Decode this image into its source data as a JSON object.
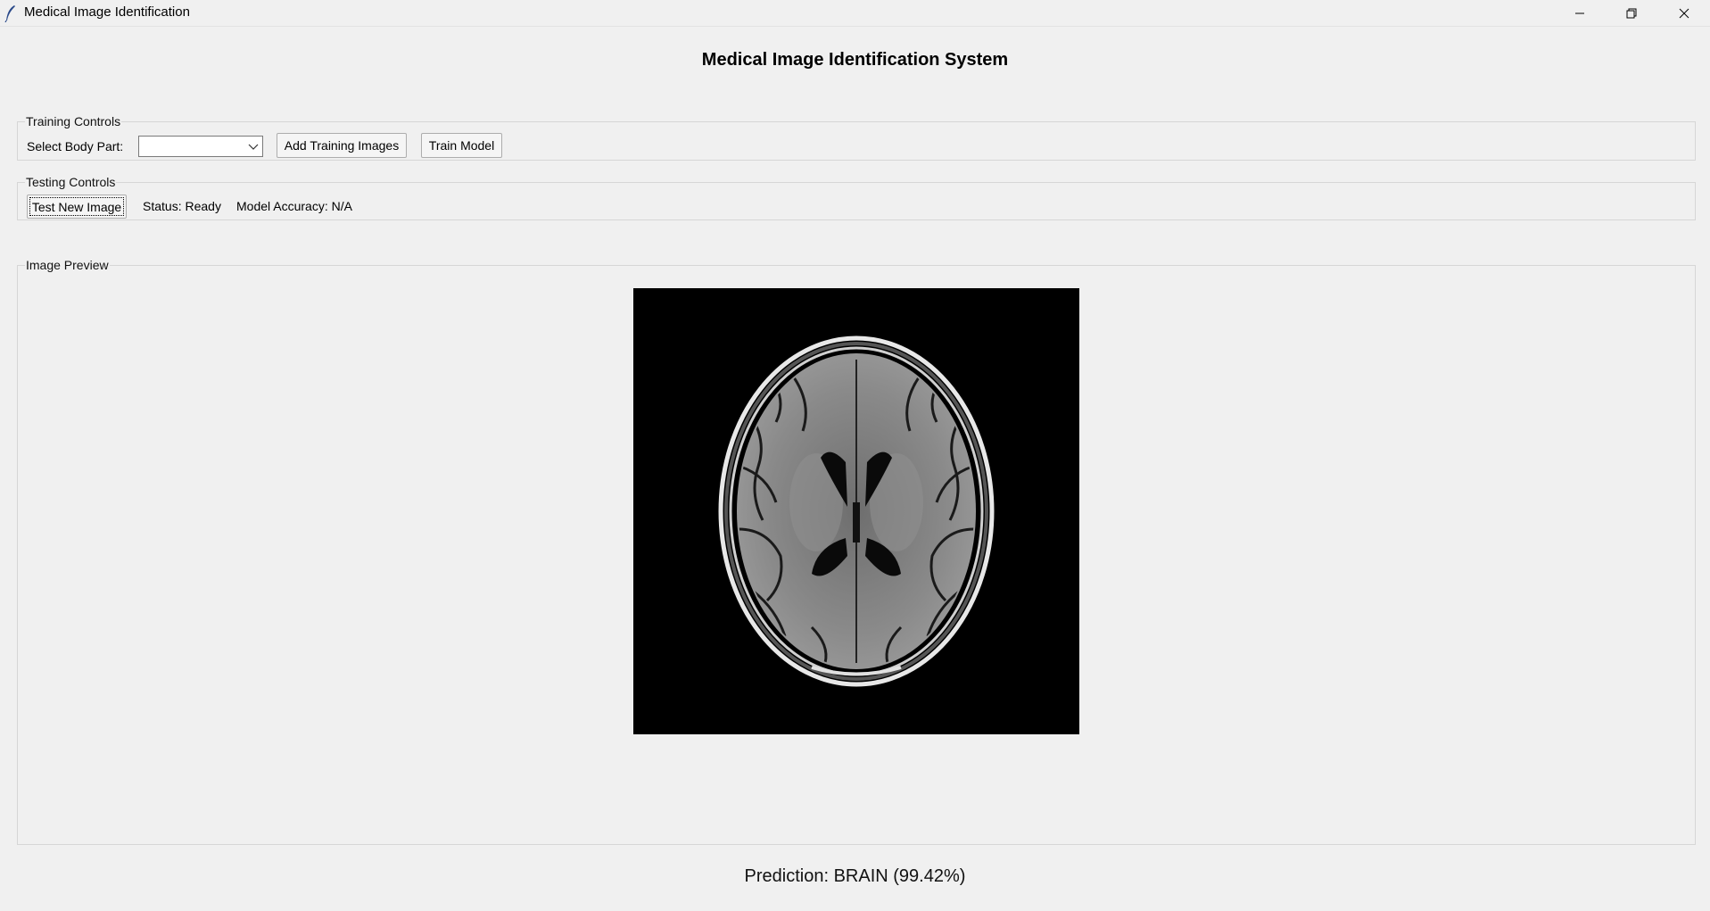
{
  "window": {
    "title": "Medical Image Identification",
    "icons": {
      "app": "feather-icon",
      "minimize": "minimize-icon",
      "maximize": "restore-icon",
      "close": "close-icon"
    }
  },
  "heading": "Medical Image Identification System",
  "training": {
    "group_label": "Training Controls",
    "body_part_label": "Select Body Part:",
    "body_part_value": "",
    "add_images_label": "Add Training Images",
    "train_model_label": "Train Model"
  },
  "testing": {
    "group_label": "Testing Controls",
    "test_button_label": "Test New Image",
    "status_text": "Status: Ready",
    "accuracy_text": "Model Accuracy: N/A"
  },
  "preview": {
    "group_label": "Image Preview",
    "image_subject": "brain MRI axial slice"
  },
  "prediction": {
    "text": "Prediction: BRAIN (99.42%)"
  }
}
